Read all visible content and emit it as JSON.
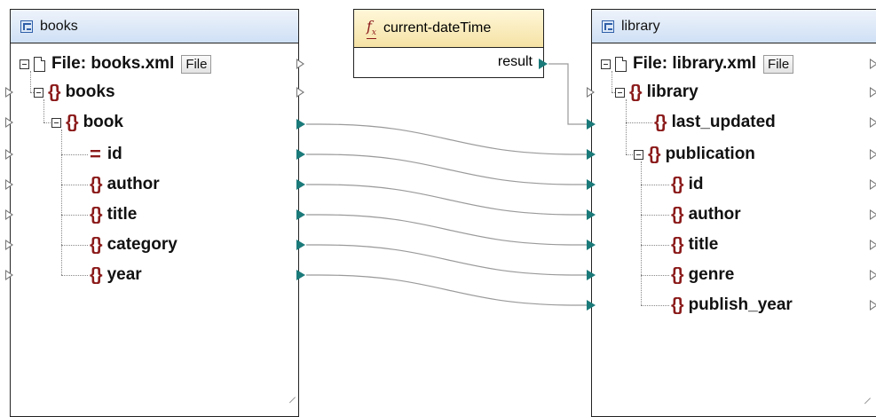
{
  "source": {
    "title": "books",
    "file_label": "File: books.xml",
    "file_button": "File",
    "nodes": [
      "books",
      "book",
      "id",
      "author",
      "title",
      "category",
      "year"
    ]
  },
  "function": {
    "title": "current-dateTime",
    "output": "result",
    "icon": "function-fx-icon"
  },
  "target": {
    "title": "library",
    "file_label": "File: library.xml",
    "file_button": "File",
    "nodes": [
      "library",
      "last_updated",
      "publication",
      "id",
      "author",
      "title",
      "genre",
      "publish_year"
    ]
  },
  "colors": {
    "connector": "#1b7a7a",
    "element_icon": "#8b1a1a",
    "header_component": "#cfe0f5",
    "header_function": "#f5e2a4"
  }
}
